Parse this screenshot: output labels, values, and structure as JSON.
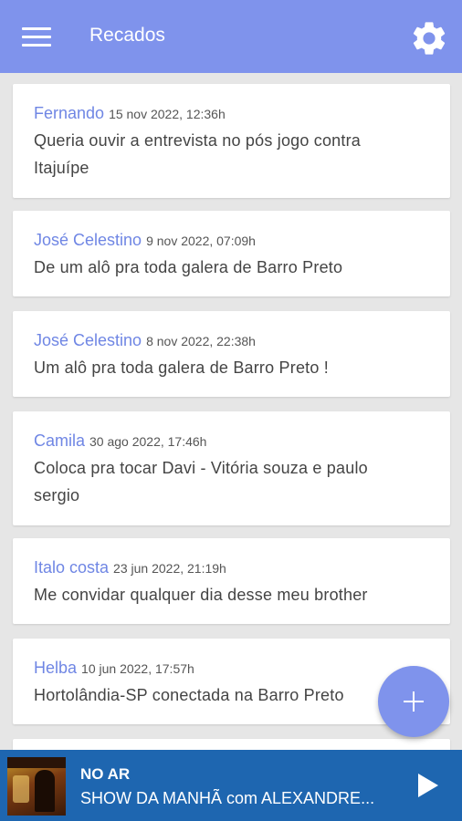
{
  "appbar": {
    "title": "Recados",
    "menu_icon": "hamburger-menu-icon",
    "settings_icon": "gear-icon",
    "color": "#7f93ec"
  },
  "messages": [
    {
      "author": "Fernando",
      "date": "15 nov 2022, 12:36h",
      "text_lines": [
        "Queria ouvir a entrevista no pós jogo contra",
        "Itajuípe"
      ]
    },
    {
      "author": "José Celestino",
      "date": "9 nov 2022, 07:09h",
      "text_lines": [
        "De um alô pra toda galera de Barro Preto"
      ]
    },
    {
      "author": "José Celestino",
      "date": "8 nov 2022, 22:38h",
      "text_lines": [
        "Um alô pra toda galera de Barro Preto !"
      ]
    },
    {
      "author": "Camila",
      "date": "30 ago 2022, 17:46h",
      "text_lines": [
        "Coloca pra tocar Davi - Vitória souza e paulo",
        "sergio"
      ]
    },
    {
      "author": "Italo costa",
      "date": "23 jun 2022, 21:19h",
      "text_lines": [
        "Me convidar qualquer dia desse meu brother"
      ]
    },
    {
      "author": "Helba",
      "date": "10 jun 2022, 17:57h",
      "text_lines": [
        "Hortolândia-SP conectada na Barro Preto"
      ]
    }
  ],
  "fab": {
    "icon": "plus-icon"
  },
  "player": {
    "status": "NO AR",
    "program": "SHOW DA MANHÃ com ALEXANDRE...",
    "play_icon": "play-icon",
    "color": "#1e66b0"
  }
}
